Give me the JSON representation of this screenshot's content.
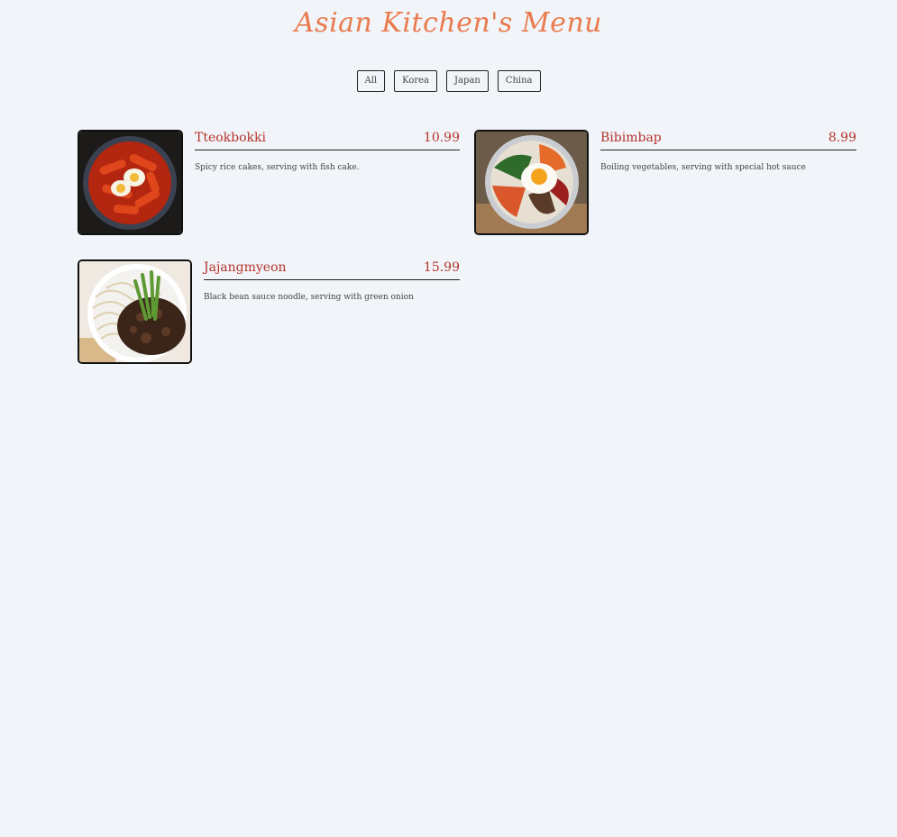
{
  "header": {
    "title": "Asian Kitchen's Menu"
  },
  "filters": [
    "All",
    "Korea",
    "Japan",
    "China"
  ],
  "items": [
    {
      "name": "Tteokbokki",
      "price": "10.99",
      "desc": "Spicy rice cakes, serving with fish cake.",
      "image": "tteokbokki-photo"
    },
    {
      "name": "Bibimbap",
      "price": "8.99",
      "desc": "Boiling vegetables, serving with special hot sauce",
      "image": "bibimbap-photo"
    },
    {
      "name": "Jajangmyeon",
      "price": "15.99",
      "desc": "Black bean sauce noodle, serving with green onion",
      "image": "jajangmyeon-photo"
    }
  ]
}
